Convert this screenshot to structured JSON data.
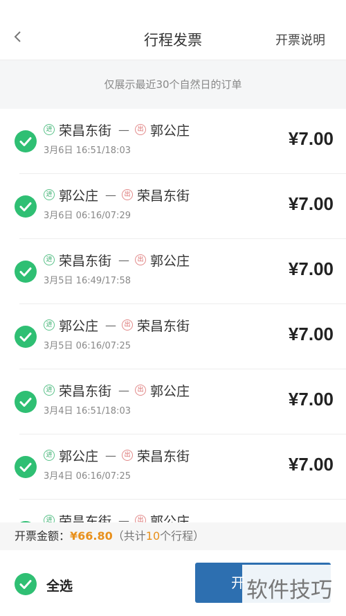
{
  "header": {
    "title": "行程发票",
    "help_link": "开票说明"
  },
  "notice": "仅展示最近30个自然日的订单",
  "badges": {
    "in": "进",
    "out": "出"
  },
  "separator": "—",
  "trips": [
    {
      "from": "荣昌东街",
      "to": "郭公庄",
      "time": "3月6日 16:51/18:03",
      "price": "¥7.00",
      "selected": true
    },
    {
      "from": "郭公庄",
      "to": "荣昌东街",
      "time": "3月6日 06:16/07:29",
      "price": "¥7.00",
      "selected": true
    },
    {
      "from": "荣昌东街",
      "to": "郭公庄",
      "time": "3月5日 16:49/17:58",
      "price": "¥7.00",
      "selected": true
    },
    {
      "from": "郭公庄",
      "to": "荣昌东街",
      "time": "3月5日 06:16/07:25",
      "price": "¥7.00",
      "selected": true
    },
    {
      "from": "荣昌东街",
      "to": "郭公庄",
      "time": "3月4日 16:51/18:03",
      "price": "¥7.00",
      "selected": true
    },
    {
      "from": "郭公庄",
      "to": "荣昌东街",
      "time": "3月4日 06:16/07:25",
      "price": "¥7.00",
      "selected": true
    },
    {
      "from": "荣昌东街",
      "to": "郭公庄",
      "time": "",
      "price": "",
      "selected": true
    }
  ],
  "total": {
    "label": "开票金额：",
    "amount": "¥66.80",
    "count_prefix": "（共计",
    "count": "10",
    "count_suffix": "个行程）"
  },
  "bottom": {
    "select_all": "全选",
    "issue_button": "开"
  },
  "watermark": "软件技巧",
  "colors": {
    "check_green": "#2fbf73",
    "amount_orange": "#e8901c",
    "button_blue": "#2d6fb0"
  }
}
